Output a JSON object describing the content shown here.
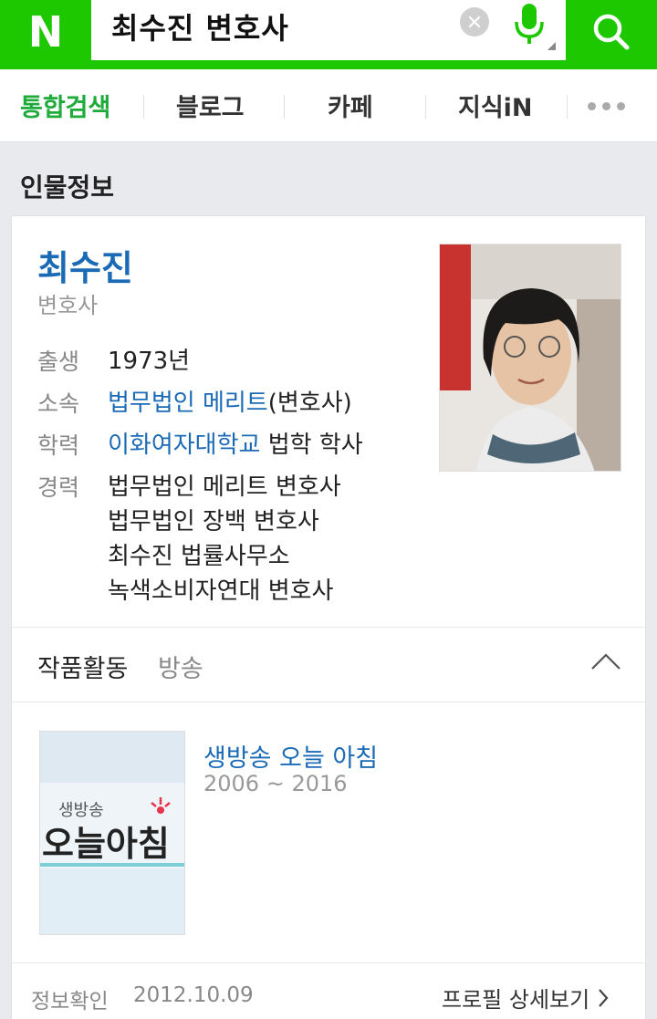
{
  "header": {
    "logo": "N",
    "query": "최수진 변호사",
    "icons": {
      "clear": "clear-icon",
      "mic": "mic-icon",
      "search": "search-icon"
    }
  },
  "tabs": [
    {
      "label": "통합검색",
      "active": true
    },
    {
      "label": "블로그"
    },
    {
      "label": "카페"
    },
    {
      "label": "지식iN"
    }
  ],
  "section_title": "인물정보",
  "person": {
    "name": "최수진",
    "occupation": "변호사",
    "birth_label": "출생",
    "birth_value": "1973년",
    "affiliation_label": "소속",
    "affiliation_link": "법무법인 메리트",
    "affiliation_suffix": "(변호사)",
    "education_label": "학력",
    "education_link": "이화여자대학교",
    "education_suffix": " 법학 학사",
    "career_label": "경력",
    "career": [
      "법무법인 메리트 변호사",
      "법무법인 장백 변호사",
      "최수진 법률사무소",
      "녹색소비자연대 변호사"
    ]
  },
  "works": {
    "title": "작품활동",
    "category": "방송",
    "item_title": "생방송 오늘 아침",
    "item_period": "2006 ~ 2016",
    "thumb_text_small": "생방송",
    "thumb_text_big": "오늘아침"
  },
  "footer": {
    "info_label": "정보확인",
    "info_date": "2012.10.09",
    "profile_link": "프로필 상세보기"
  },
  "colors": {
    "brand": "#1ec800",
    "link": "#1a6ab6",
    "active_tab": "#1eab3a"
  }
}
